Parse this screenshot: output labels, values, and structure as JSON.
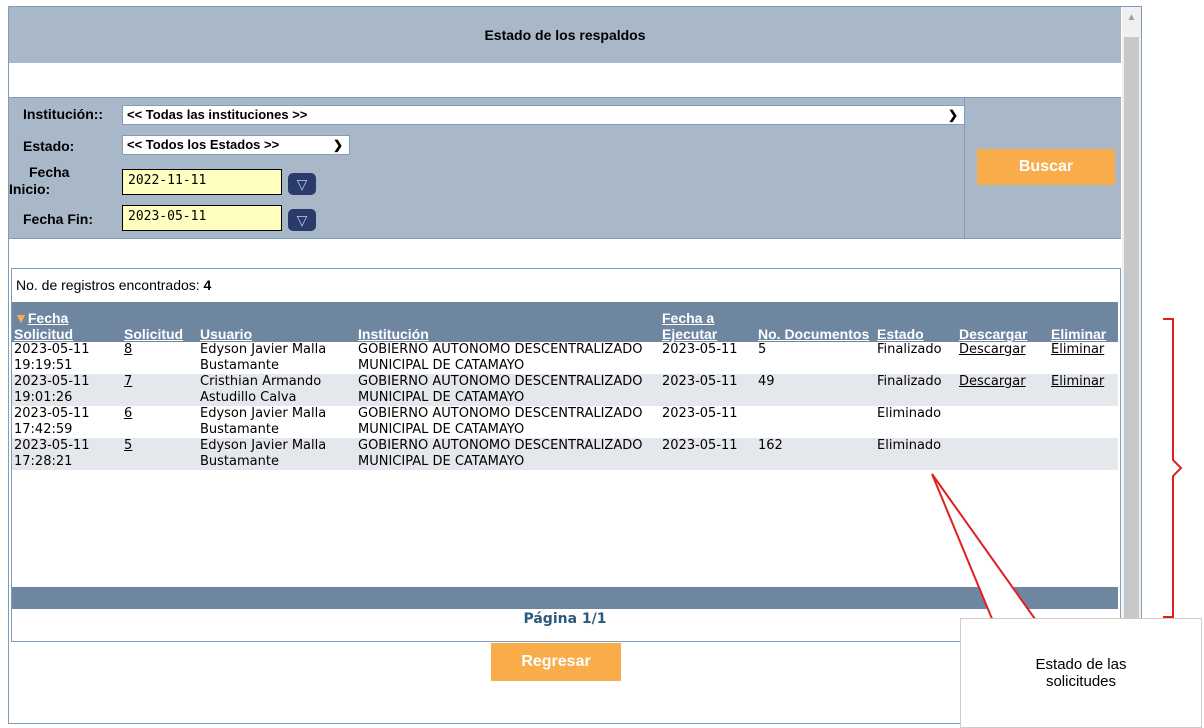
{
  "header": {
    "title": "Estado de los respaldos"
  },
  "filters": {
    "institucion_label": "Institución::",
    "institucion_value": "<< Todas las instituciones >>",
    "estado_label": "Estado:",
    "estado_value": "<< Todos los Estados >>",
    "fecha_inicio_label_1": "Fecha",
    "fecha_inicio_label_2": "Inicio:",
    "fecha_inicio_value": "2022-11-11",
    "fecha_fin_label": "Fecha Fin:",
    "fecha_fin_value": "2023-05-11",
    "buscar": "Buscar"
  },
  "results": {
    "count_label": "No. de registros encontrados:",
    "count_value": "4",
    "columns": [
      "Fecha Solicitud",
      "Solicitud",
      "Usuario",
      "Institución",
      "Fecha a Ejecutar",
      "No. Documentos",
      "Estado",
      "Descargar",
      "Eliminar"
    ],
    "rows": [
      {
        "fecha": "2023-05-11 19:19:51",
        "solicitud": "8",
        "usuario": "Edyson Javier Malla Bustamante",
        "institucion": "GOBIERNO AUTONOMO DESCENTRALIZADO MUNICIPAL DE CATAMAYO",
        "fecha_ejecutar": "2023-05-11",
        "documentos": "5",
        "estado": "Finalizado",
        "descargar": "Descargar",
        "eliminar": "Eliminar"
      },
      {
        "fecha": "2023-05-11 19:01:26",
        "solicitud": "7",
        "usuario": "Cristhian Armando Astudillo Calva",
        "institucion": "GOBIERNO AUTONOMO DESCENTRALIZADO MUNICIPAL DE CATAMAYO",
        "fecha_ejecutar": "2023-05-11",
        "documentos": "49",
        "estado": "Finalizado",
        "descargar": "Descargar",
        "eliminar": "Eliminar"
      },
      {
        "fecha": "2023-05-11 17:42:59",
        "solicitud": "6",
        "usuario": "Edyson Javier Malla Bustamante",
        "institucion": "GOBIERNO AUTONOMO DESCENTRALIZADO MUNICIPAL DE CATAMAYO",
        "fecha_ejecutar": "2023-05-11",
        "documentos": "",
        "estado": "Eliminado",
        "descargar": "",
        "eliminar": ""
      },
      {
        "fecha": "2023-05-11 17:28:21",
        "solicitud": "5",
        "usuario": "Edyson Javier Malla Bustamante",
        "institucion": "GOBIERNO AUTONOMO DESCENTRALIZADO MUNICIPAL DE CATAMAYO",
        "fecha_ejecutar": "2023-05-11",
        "documentos": "162",
        "estado": "Eliminado",
        "descargar": "",
        "eliminar": ""
      }
    ],
    "page_label": "Página 1/1"
  },
  "footer": {
    "regresar": "Regresar"
  },
  "callout": {
    "line1": "Estado de las",
    "line2": "solicitudes"
  },
  "colors": {
    "header_bg": "#a8b8c8",
    "table_header": "#6f86a0",
    "button": "#f9ad4a",
    "date_bg": "#ffffc0",
    "callout_arrow": "#e02020"
  }
}
